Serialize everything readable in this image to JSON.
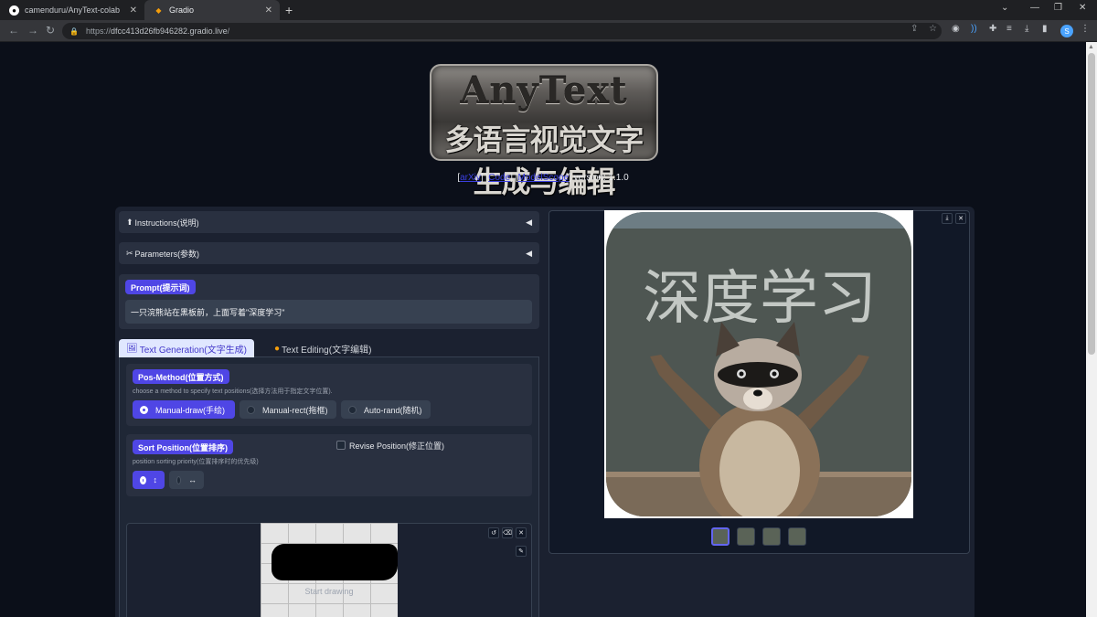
{
  "browser": {
    "tabs": [
      {
        "title": "camenduru/AnyText-colab",
        "active": false
      },
      {
        "title": "Gradio",
        "active": true
      }
    ],
    "url_prefix": "https://",
    "url_domain": "dfcc413d26fb946282.gradio.live",
    "url_path": "/",
    "profile_initial": "S"
  },
  "header": {
    "logo_line1": "AnyText",
    "logo_line2": "多语言视觉文字生成与编辑",
    "link_arxiv": "arXiv",
    "link_code": "Code",
    "link_modelscope": "ModelScope",
    "version_text": "version: 1.1.0"
  },
  "left": {
    "instructions_label": "Instructions(说明)",
    "parameters_label": "Parameters(参数)",
    "prompt_label": "Prompt(提示词)",
    "prompt_value": "一只浣熊站在黑板前，上面写着\"深度学习\"",
    "tab_generation": "Text Generation(文字生成)",
    "tab_editing": "Text Editing(文字编辑)",
    "pos_method_label": "Pos-Method(位置方式)",
    "pos_method_hint": "choose a method to specify text positions(选择方法用于指定文字位置).",
    "pos_options": [
      "Manual-draw(手绘)",
      "Manual-rect(拖框)",
      "Auto-rand(随机)"
    ],
    "pos_selected": "Manual-draw(手绘)",
    "sort_label": "Sort Position(位置排序)",
    "sort_hint": "position sorting priority(位置排序时的优先级)",
    "sort_options": [
      "↕",
      "↔"
    ],
    "revise_label": "Revise Position(修正位置)",
    "canvas_hint": "Start drawing"
  },
  "right": {
    "image_text": "深度学习",
    "thumbnail_count": 4
  },
  "colors": {
    "page_bg": "#0b0f19",
    "panel_bg": "#293040",
    "accent": "#4f46e5",
    "link": "#3b3fe0"
  }
}
